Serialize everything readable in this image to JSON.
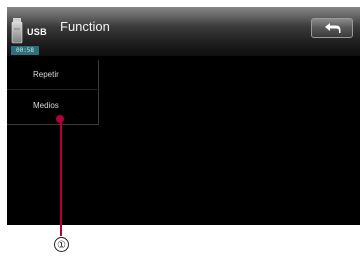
{
  "header": {
    "title": "Function",
    "source_label": "USB",
    "time": "00:58",
    "back_icon": "back-arrow-icon"
  },
  "menu": {
    "items": [
      {
        "label": "Repetir"
      },
      {
        "label": "Medios"
      }
    ]
  },
  "annotation": {
    "callout": "①"
  },
  "colors": {
    "callout": "#b3003b",
    "screen_bg": "#000000"
  }
}
